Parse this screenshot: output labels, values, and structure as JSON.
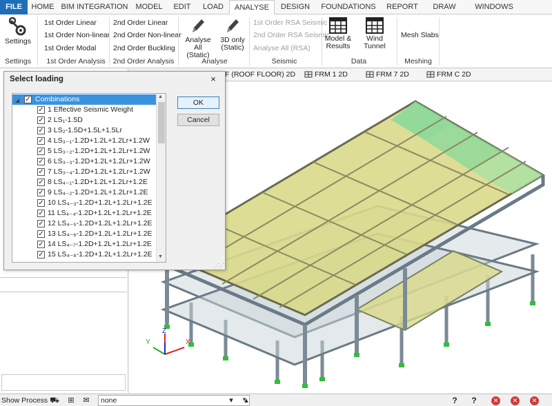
{
  "tabs": [
    "FILE",
    "HOME",
    "BIM INTEGRATION",
    "MODEL",
    "EDIT",
    "LOAD",
    "ANALYSE",
    "DESIGN",
    "FOUNDATIONS",
    "REPORT",
    "DRAW",
    "WINDOWS"
  ],
  "active_tab": "ANALYSE",
  "ribbon": {
    "settings": {
      "label": "Settings",
      "group": "Settings"
    },
    "first_order": {
      "items": [
        "1st Order Linear",
        "1st Order Non-linear",
        "1st Order Modal"
      ],
      "group": "1st Order Analysis"
    },
    "second_order": {
      "items": [
        "2nd Order Linear",
        "2nd Order Non-linear",
        "2nd Order Buckling"
      ],
      "group": "2nd Order Analysis"
    },
    "analyse": {
      "analyse_all": "Analyse All\n(Static)",
      "analyse_all_l1": "Analyse All",
      "analyse_all_l2": "(Static)",
      "three_d_l1": "3D only",
      "three_d_l2": "(Static)",
      "group": "Analyse"
    },
    "seismic": {
      "items": [
        "1st Order RSA Seismic",
        "2nd Order RSA Seismic",
        "Analyse All (RSA)"
      ],
      "group": "Seismic"
    },
    "data": {
      "model_results_l1": "Model &",
      "model_results_l2": "Results",
      "wind_tunnel": "Wind Tunnel",
      "group": "Data"
    },
    "meshing": {
      "mesh_slabs": "Mesh Slabs",
      "group": "Meshing"
    }
  },
  "view_tabs": [
    "F (ROOF FLOOR) 2D",
    "FRM 1 2D",
    "FRM 7 2D",
    "FRM C 2D"
  ],
  "dialog": {
    "title": "Select loading",
    "close": "×",
    "root_label": "Combinations",
    "items": [
      "1 Effective Seismic Weight",
      "2 LS₁-1.5D",
      "3 LS₂-1.5D+1.5L+1.5Lr",
      "4 LS₃₋₁-1.2D+1.2L+1.2Lr+1.2W",
      "5 LS₃₋₂-1.2D+1.2L+1.2Lr+1.2W",
      "6 LS₃₋₃-1.2D+1.2L+1.2Lr+1.2W",
      "7 LS₃₋₄-1.2D+1.2L+1.2Lr+1.2W",
      "8 LS₄₋₁-1.2D+1.2L+1.2Lr+1.2E",
      "9 LS₄₋₂-1.2D+1.2L+1.2Lr+1.2E",
      "10 LS₄₋₃-1.2D+1.2L+1.2Lr+1.2E",
      "11 LS₄₋₄-1.2D+1.2L+1.2Lr+1.2E",
      "12 LS₄₋₅-1.2D+1.2L+1.2Lr+1.2E",
      "13 LS₄₋₆-1.2D+1.2L+1.2Lr+1.2E",
      "14 LS₄₋₇-1.2D+1.2L+1.2Lr+1.2E",
      "15 LS₄₋₈-1.2D+1.2L+1.2Lr+1.2E"
    ],
    "ok": "OK",
    "cancel": "Cancel"
  },
  "axes": {
    "x": "X",
    "y": "Y",
    "z": "Z"
  },
  "statusbar": {
    "text": "Show Process",
    "combo_value": "none"
  },
  "colors": {
    "file_tab": "#1e6fb8",
    "selection": "#3a92de",
    "slab": "#d9d98a",
    "slab_green": "#7fd99a",
    "frame": "#7a8a96",
    "support": "#2fbf3a"
  }
}
